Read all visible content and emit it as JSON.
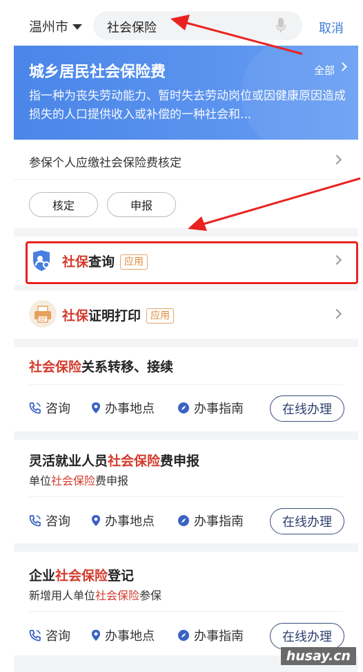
{
  "header": {
    "city": "温州市",
    "search_value": "社会保险",
    "cancel_label": "取消"
  },
  "banner": {
    "title": "城乡居民社会保险费",
    "all_label": "全部",
    "description": "指一种为丧失劳动能力、暂时失去劳动岗位或因健康原因造成损失的人口提供收入或补偿的一种社会和..."
  },
  "item_link": {
    "label": "参保个人应缴社会保险费核定"
  },
  "pills": [
    "核定",
    "申报"
  ],
  "apps": [
    {
      "hl": "社保",
      "rest": "查询",
      "tag": "应用",
      "icon": "user-search-icon"
    },
    {
      "hl": "社保",
      "rest": "证明打印",
      "tag": "应用",
      "icon": "printer-icon"
    }
  ],
  "services": [
    {
      "title_pre": "",
      "title_hl": "社会保险",
      "title_post": "关系转移、接续",
      "sub_pre": "",
      "sub_hl": "",
      "sub_post": ""
    },
    {
      "title_pre": "灵活就业人员",
      "title_hl": "社会保险",
      "title_post": "费申报",
      "sub_pre": "单位",
      "sub_hl": "社会保险",
      "sub_post": "费申报"
    },
    {
      "title_pre": "企业",
      "title_hl": "社会保险",
      "title_post": "登记",
      "sub_pre": "新增用人单位",
      "sub_hl": "社会保险",
      "sub_post": "参保"
    }
  ],
  "actions": {
    "consult": "咨询",
    "location": "办事地点",
    "guide": "办事指南",
    "online": "在线办理"
  },
  "watermark": "husay.cn",
  "colors": {
    "accent_blue": "#4a86e8",
    "highlight_red": "#d33b2c",
    "annotation_red": "#e8231f",
    "tag_orange": "#e08a3c"
  }
}
